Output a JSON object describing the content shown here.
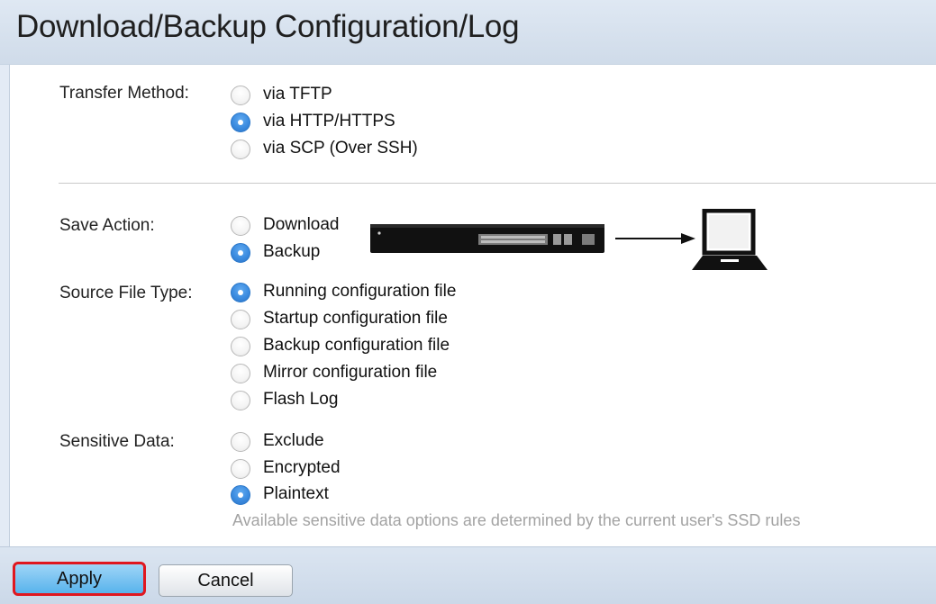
{
  "page": {
    "title": "Download/Backup Configuration/Log"
  },
  "transfer_method": {
    "label": "Transfer Method:",
    "options": [
      {
        "label": "via TFTP",
        "checked": false
      },
      {
        "label": "via HTTP/HTTPS",
        "checked": true
      },
      {
        "label": "via SCP (Over SSH)",
        "checked": false
      }
    ]
  },
  "save_action": {
    "label": "Save Action:",
    "options": [
      {
        "label": "Download",
        "checked": false
      },
      {
        "label": "Backup",
        "checked": true
      }
    ]
  },
  "source_file_type": {
    "label": "Source File Type:",
    "options": [
      {
        "label": "Running configuration file",
        "checked": true
      },
      {
        "label": "Startup configuration file",
        "checked": false
      },
      {
        "label": "Backup configuration file",
        "checked": false
      },
      {
        "label": "Mirror configuration file",
        "checked": false
      },
      {
        "label": "Flash Log",
        "checked": false
      }
    ]
  },
  "sensitive_data": {
    "label": "Sensitive Data:",
    "options": [
      {
        "label": "Exclude",
        "checked": false
      },
      {
        "label": "Encrypted",
        "checked": false
      },
      {
        "label": "Plaintext",
        "checked": true
      }
    ],
    "note": "Available sensitive data options are determined by the current user's SSD rules"
  },
  "footer": {
    "apply_label": "Apply",
    "cancel_label": "Cancel"
  },
  "icons": {
    "switch": "network-switch-icon",
    "computer": "computer-icon",
    "arrow": "arrow-right-icon"
  },
  "colors": {
    "header": "#d6e1ee",
    "radio_checked": "#3c8ce0",
    "apply_highlight": "#e0171f",
    "apply_button": "#58b3ec"
  }
}
